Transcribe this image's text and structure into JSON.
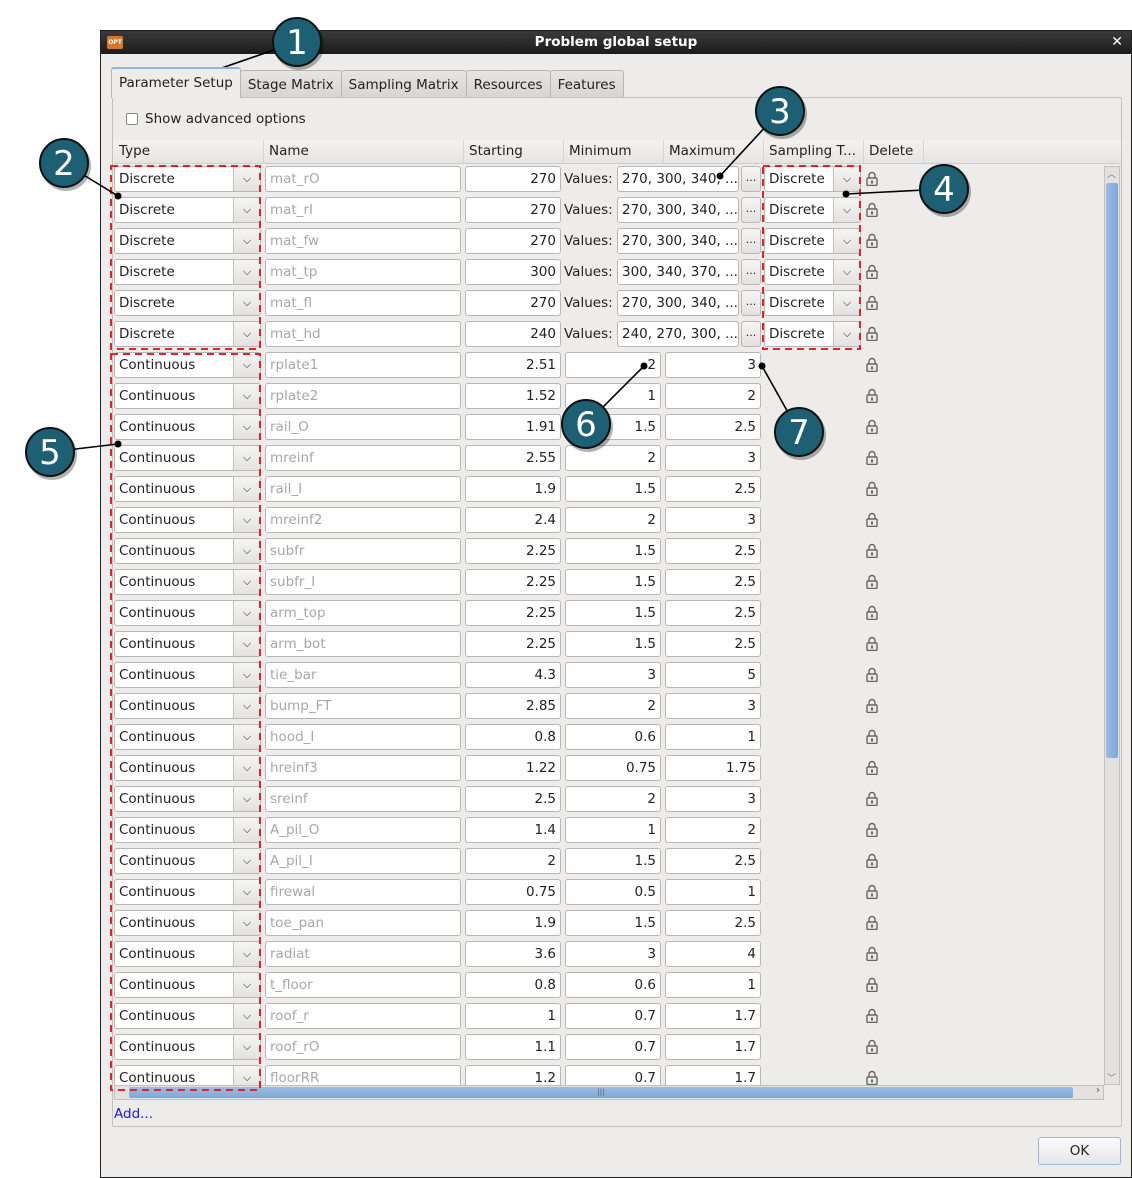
{
  "window": {
    "title": "Problem global setup",
    "close_icon": "close-icon",
    "app_icon": "OPT"
  },
  "tabs": [
    {
      "label": "Parameter Setup",
      "active": true
    },
    {
      "label": "Stage Matrix"
    },
    {
      "label": "Sampling Matrix"
    },
    {
      "label": "Resources"
    },
    {
      "label": "Features"
    }
  ],
  "show_advanced": {
    "label": "Show advanced options",
    "checked": false
  },
  "columns": [
    "Type",
    "Name",
    "Starting",
    "Minimum",
    "Maximum",
    "Sampling T...",
    "Delete"
  ],
  "values_label": "Values:",
  "ellipsis_button": "...",
  "rows": [
    {
      "type": "Discrete",
      "name": "mat_rO",
      "start": "270",
      "values": "270, 300, 340, ...",
      "sampling": "Discrete"
    },
    {
      "type": "Discrete",
      "name": "mat_rI",
      "start": "270",
      "values": "270, 300, 340, ...",
      "sampling": "Discrete"
    },
    {
      "type": "Discrete",
      "name": "mat_fw",
      "start": "270",
      "values": "270, 300, 340, ...",
      "sampling": "Discrete"
    },
    {
      "type": "Discrete",
      "name": "mat_tp",
      "start": "300",
      "values": "300, 340, 370, ...",
      "sampling": "Discrete"
    },
    {
      "type": "Discrete",
      "name": "mat_fl",
      "start": "270",
      "values": "270, 300, 340, ...",
      "sampling": "Discrete"
    },
    {
      "type": "Discrete",
      "name": "mat_hd",
      "start": "240",
      "values": "240, 270, 300, ...",
      "sampling": "Discrete"
    },
    {
      "type": "Continuous",
      "name": "rplate1",
      "start": "2.51",
      "min": "2",
      "max": "3"
    },
    {
      "type": "Continuous",
      "name": "rplate2",
      "start": "1.52",
      "min": "1",
      "max": "2"
    },
    {
      "type": "Continuous",
      "name": "rail_O",
      "start": "1.91",
      "min": "1.5",
      "max": "2.5"
    },
    {
      "type": "Continuous",
      "name": "mreinf",
      "start": "2.55",
      "min": "2",
      "max": "3"
    },
    {
      "type": "Continuous",
      "name": "rail_I",
      "start": "1.9",
      "min": "1.5",
      "max": "2.5"
    },
    {
      "type": "Continuous",
      "name": "mreinf2",
      "start": "2.4",
      "min": "2",
      "max": "3"
    },
    {
      "type": "Continuous",
      "name": "subfr",
      "start": "2.25",
      "min": "1.5",
      "max": "2.5"
    },
    {
      "type": "Continuous",
      "name": "subfr_I",
      "start": "2.25",
      "min": "1.5",
      "max": "2.5"
    },
    {
      "type": "Continuous",
      "name": "arm_top",
      "start": "2.25",
      "min": "1.5",
      "max": "2.5"
    },
    {
      "type": "Continuous",
      "name": "arm_bot",
      "start": "2.25",
      "min": "1.5",
      "max": "2.5"
    },
    {
      "type": "Continuous",
      "name": "tie_bar",
      "start": "4.3",
      "min": "3",
      "max": "5"
    },
    {
      "type": "Continuous",
      "name": "bump_FT",
      "start": "2.85",
      "min": "2",
      "max": "3"
    },
    {
      "type": "Continuous",
      "name": "hood_I",
      "start": "0.8",
      "min": "0.6",
      "max": "1"
    },
    {
      "type": "Continuous",
      "name": "hreinf3",
      "start": "1.22",
      "min": "0.75",
      "max": "1.75"
    },
    {
      "type": "Continuous",
      "name": "sreinf",
      "start": "2.5",
      "min": "2",
      "max": "3"
    },
    {
      "type": "Continuous",
      "name": "A_pil_O",
      "start": "1.4",
      "min": "1",
      "max": "2"
    },
    {
      "type": "Continuous",
      "name": "A_pil_I",
      "start": "2",
      "min": "1.5",
      "max": "2.5"
    },
    {
      "type": "Continuous",
      "name": "firewal",
      "start": "0.75",
      "min": "0.5",
      "max": "1"
    },
    {
      "type": "Continuous",
      "name": "toe_pan",
      "start": "1.9",
      "min": "1.5",
      "max": "2.5"
    },
    {
      "type": "Continuous",
      "name": "radiat",
      "start": "3.6",
      "min": "3",
      "max": "4"
    },
    {
      "type": "Continuous",
      "name": "t_floor",
      "start": "0.8",
      "min": "0.6",
      "max": "1"
    },
    {
      "type": "Continuous",
      "name": "roof_r",
      "start": "1",
      "min": "0.7",
      "max": "1.7"
    },
    {
      "type": "Continuous",
      "name": "roof_rO",
      "start": "1.1",
      "min": "0.7",
      "max": "1.7"
    },
    {
      "type": "Continuous",
      "name": "floorRR",
      "start": "1.2",
      "min": "0.7",
      "max": "1.7"
    }
  ],
  "add_link": "Add...",
  "ok_button": "OK",
  "annotations": [
    "1",
    "2",
    "3",
    "4",
    "5",
    "6",
    "7"
  ],
  "colors": {
    "callout": "#1d5f73",
    "highlight": "#e8202a",
    "scroll": "#8cb2de",
    "link": "#1a1aee"
  }
}
